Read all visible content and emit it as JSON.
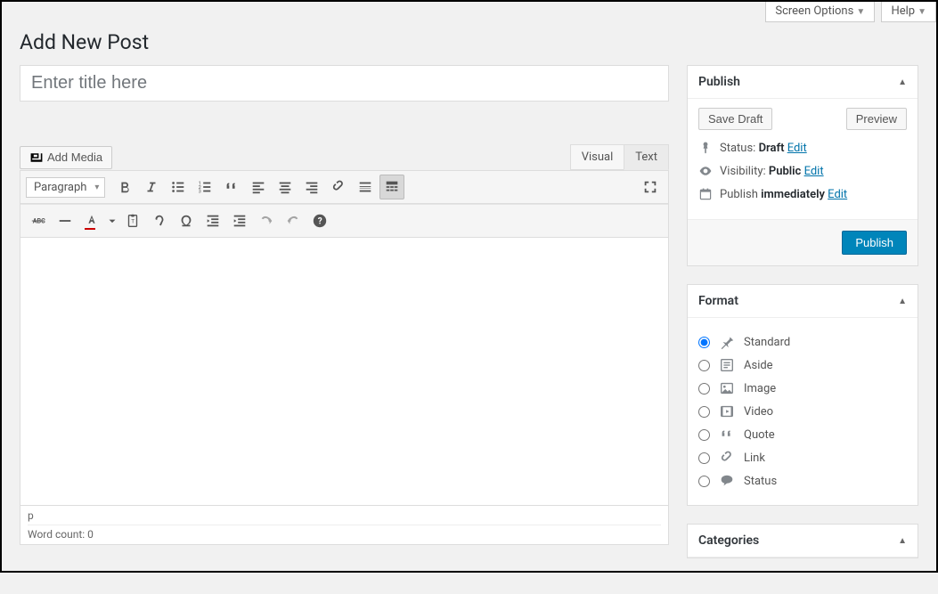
{
  "topTabs": {
    "screenOptions": "Screen Options",
    "help": "Help"
  },
  "heading": "Add New Post",
  "titlePlaceholder": "Enter title here",
  "addMedia": "Add Media",
  "editorTabs": {
    "visual": "Visual",
    "text": "Text"
  },
  "paragraphSelect": "Paragraph",
  "statusPath": "p",
  "wordCount": "Word count: 0",
  "publish": {
    "title": "Publish",
    "saveDraft": "Save Draft",
    "preview": "Preview",
    "statusLabel": "Status:",
    "statusValue": "Draft",
    "visibilityLabel": "Visibility:",
    "visibilityValue": "Public",
    "publishLabel": "Publish",
    "publishValue": "immediately",
    "edit": "Edit",
    "button": "Publish"
  },
  "format": {
    "title": "Format",
    "items": [
      {
        "label": "Standard"
      },
      {
        "label": "Aside"
      },
      {
        "label": "Image"
      },
      {
        "label": "Video"
      },
      {
        "label": "Quote"
      },
      {
        "label": "Link"
      },
      {
        "label": "Status"
      }
    ]
  },
  "categories": {
    "title": "Categories"
  }
}
